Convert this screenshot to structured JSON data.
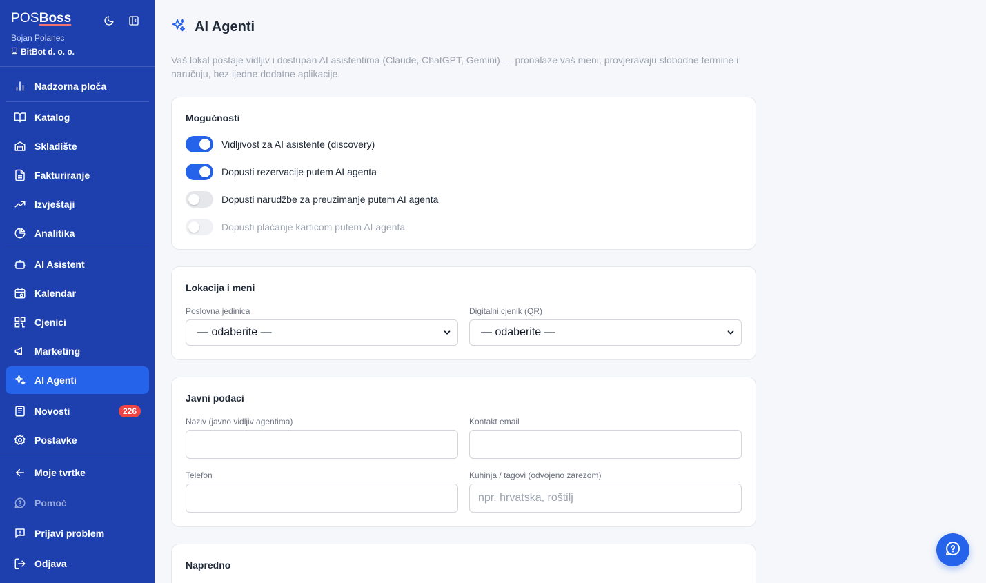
{
  "brand": {
    "pos": "POS",
    "boss": "Boss"
  },
  "user": {
    "name": "Bojan Polanec",
    "company": "BitBot d. o. o."
  },
  "nav": [
    {
      "label": "Nadzorna ploča",
      "icon": "bar-chart-icon"
    },
    {
      "label": "Katalog",
      "icon": "book-icon"
    },
    {
      "label": "Skladište",
      "icon": "warehouse-icon"
    },
    {
      "label": "Fakturiranje",
      "icon": "document-icon"
    },
    {
      "label": "Izvještaji",
      "icon": "trending-up-icon"
    },
    {
      "label": "Analitika",
      "icon": "pie-chart-icon"
    },
    {
      "label": "AI Asistent",
      "icon": "bot-icon"
    },
    {
      "label": "Kalendar",
      "icon": "calendar-icon"
    },
    {
      "label": "Cjenici",
      "icon": "qr-code-icon"
    },
    {
      "label": "Marketing",
      "icon": "megaphone-icon"
    },
    {
      "label": "AI Agenti",
      "icon": "sparkles-icon",
      "active": true
    },
    {
      "label": "Novosti",
      "icon": "newspaper-icon",
      "badge": "226"
    },
    {
      "label": "Postavke",
      "icon": "gear-icon"
    },
    {
      "label": "Moje tvrtke",
      "icon": "arrow-left-icon"
    },
    {
      "label": "Pomoć",
      "icon": "help-icon",
      "muted": true
    },
    {
      "label": "Prijavi problem",
      "icon": "report-icon"
    },
    {
      "label": "Odjava",
      "icon": "logout-icon"
    }
  ],
  "page": {
    "title": "AI Agenti",
    "description": "Vaš lokal postaje vidljiv i dostupan AI asistentima (Claude, ChatGPT, Gemini) — pronalaze vaš meni, provjeravaju slobodne termine i naručuju, bez ijedne dodatne aplikacije."
  },
  "capabilities": {
    "title": "Mogućnosti",
    "toggles": [
      {
        "label": "Vidljivost za AI asistente (discovery)",
        "on": true
      },
      {
        "label": "Dopusti rezervacije putem AI agenta",
        "on": true
      },
      {
        "label": "Dopusti narudžbe za preuzimanje putem AI agenta",
        "on": false
      },
      {
        "label": "Dopusti plaćanje karticom putem AI agenta",
        "on": false,
        "disabled": true
      }
    ]
  },
  "location": {
    "title": "Lokacija i meni",
    "unit_label": "Poslovna jedinica",
    "unit_value": "— odaberite —",
    "menu_label": "Digitalni cjenik (QR)",
    "menu_value": "— odaberite —"
  },
  "public_data": {
    "title": "Javni podaci",
    "name_label": "Naziv (javno vidljiv agentima)",
    "name_value": "",
    "email_label": "Kontakt email",
    "email_value": "",
    "phone_label": "Telefon",
    "phone_value": "",
    "tags_label": "Kuhinja / tagovi (odvojeno zarezom)",
    "tags_placeholder": "npr. hrvatska, roštilj"
  },
  "advanced": {
    "title": "Napredno"
  },
  "colors": {
    "sidebar": "#1e40af",
    "accent": "#2563eb",
    "badge": "#ef4444"
  }
}
